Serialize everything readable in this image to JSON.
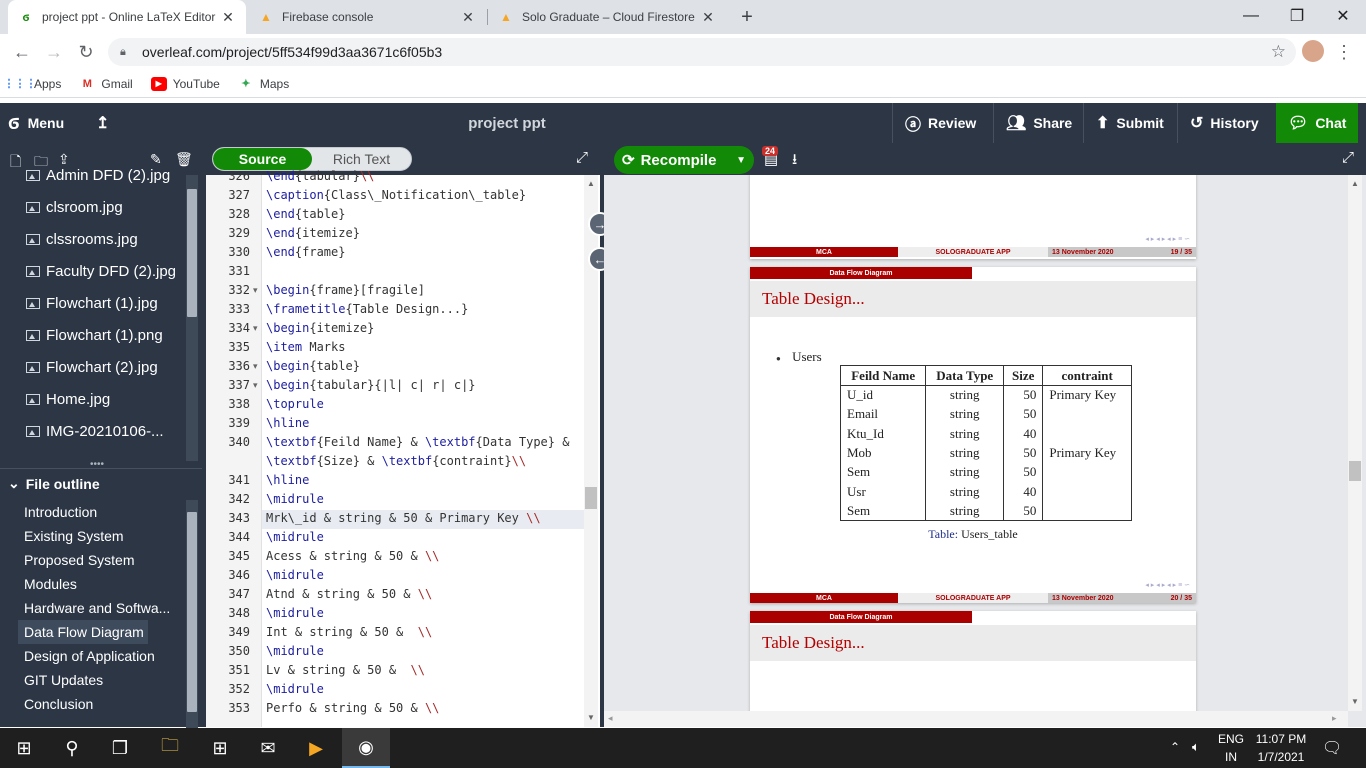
{
  "browser": {
    "tabs": [
      {
        "title": "project ppt - Online LaTeX Editor",
        "icon": "overleaf-icon"
      },
      {
        "title": "Firebase console",
        "icon": "firebase-icon"
      },
      {
        "title": "Solo Graduate – Cloud Firestore",
        "icon": "firebase-icon"
      }
    ],
    "new_tab": "+",
    "url": "overleaf.com/project/5ff534f99d3aa3671c6f05b3",
    "bookmarks": [
      "Apps",
      "Gmail",
      "YouTube",
      "Maps"
    ]
  },
  "header": {
    "menu": "Menu",
    "project_title": "project ppt",
    "review": "Review",
    "share": "Share",
    "submit": "Submit",
    "history": "History",
    "chat": "Chat"
  },
  "files": [
    "Admin DFD (2).jpg",
    "clsroom.jpg",
    "clssrooms.jpg",
    "Faculty DFD (2).jpg",
    "Flowchart (1).jpg",
    "Flowchart (1).png",
    "Flowchart (2).jpg",
    "Home.jpg",
    "IMG-20210106-..."
  ],
  "outline": {
    "title": "File outline",
    "items": [
      "Introduction",
      "Existing System",
      "Proposed System",
      "Modules",
      "Hardware and Softwa...",
      "Data Flow Diagram",
      "Design of Application",
      "GIT Updates",
      "Conclusion"
    ],
    "active_index": 5
  },
  "editor": {
    "mode_source": "Source",
    "mode_rich": "Rich Text",
    "line_numbers": [
      "326",
      "327",
      "328",
      "329",
      "330",
      "331",
      "332",
      "333",
      "334",
      "335",
      "336",
      "337",
      "338",
      "339",
      "340",
      "",
      "341",
      "342",
      "343",
      "344",
      "345",
      "346",
      "347",
      "348",
      "349",
      "350",
      "351",
      "352",
      "353"
    ],
    "lines": [
      "\\end{tabular}\\\\",
      "\\caption{Class\\_Notification\\_table}",
      "\\end{table}",
      "\\end{itemize}",
      "\\end{frame}",
      "",
      "\\begin{frame}[fragile]",
      "\\frametitle{Table Design...}",
      "\\begin{itemize}",
      "\\item Marks",
      "\\begin{table}",
      "\\begin{tabular}{|l| c| r| c|}",
      "\\toprule",
      "\\hline",
      "\\textbf{Feild Name} & \\textbf{Data Type} &",
      "\\textbf{Size} & \\textbf{contraint}\\\\",
      "\\hline",
      "\\midrule",
      "Mrk\\_id & string & 50 & Primary Key \\\\",
      "\\midrule",
      "Acess & string & 50 & \\\\",
      "\\midrule",
      "Atnd & string & 50 & \\\\",
      "\\midrule",
      "Int & string & 50 &  \\\\",
      "\\midrule",
      "Lv & string & 50 &  \\\\",
      "\\midrule",
      "Perfo & string & 50 & \\\\"
    ],
    "fold_lines": [
      6,
      8,
      10,
      11
    ],
    "active_line": 18
  },
  "pdf": {
    "recompile": "Recompile",
    "badge": "24",
    "footer_left": "MCA",
    "footer_mid": "SOLOGRADUATE APP",
    "footer_date": "13 November 2020",
    "page_a": "19 / 35",
    "page_b": "20 / 35",
    "section": "Data Flow Diagram",
    "frame_title": "Table Design...",
    "bullet": "Users",
    "table": {
      "headers": [
        "Feild Name",
        "Data Type",
        "Size",
        "contraint"
      ],
      "rows": [
        [
          "U_id",
          "string",
          "50",
          "Primary Key"
        ],
        [
          "Email",
          "string",
          "50",
          ""
        ],
        [
          "Ktu_Id",
          "string",
          "40",
          ""
        ],
        [
          "Mob",
          "string",
          "50",
          "Primary Key"
        ],
        [
          "Sem",
          "string",
          "50",
          ""
        ],
        [
          "Usr",
          "string",
          "40",
          ""
        ],
        [
          "Sem",
          "string",
          "50",
          ""
        ]
      ]
    },
    "caption_label": "Table:",
    "caption_text": "Users_table"
  },
  "taskbar": {
    "lang1": "ENG",
    "lang2": "IN",
    "time": "11:07 PM",
    "date": "1/7/2021"
  },
  "colors": {
    "overleaf_dark": "#2c3645",
    "overleaf_green": "#138a07",
    "beamer_red": "#aa0000"
  }
}
